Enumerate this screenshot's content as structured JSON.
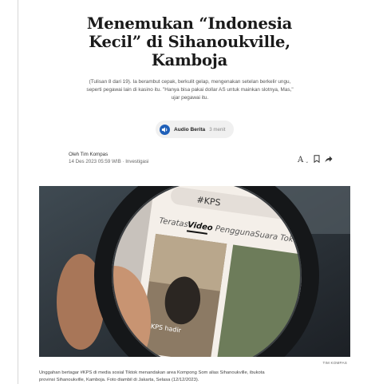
{
  "article": {
    "title_line1": "Menemukan “Indonesia",
    "title_line2": "Kecil” di Sihanoukville,",
    "title_line3": "Kamboja",
    "lede_line1": "(Tulisan 8 dari 19). Ia berambut cepak, berkulit gelap, mengenakan setelan berkelir ungu,",
    "lede_line2": "seperti pegawai lain di kasino itu. \"Hanya bisa pakai dollar AS untuk mainkan slotnya, Mas,\"",
    "lede_line3": "ujar pegawai itu."
  },
  "audio": {
    "label": "Audio Berita",
    "duration": "3 menit",
    "icon": "speaker-icon",
    "accent": "#1f5fb8"
  },
  "byline": {
    "author_line": "Oleh Tim Kompas",
    "date_line": "14 Des 2023 05:59 WIB · Investigasi"
  },
  "toolbar": {
    "font_size_label": "A",
    "font_chevron_icon": "chevron-down-icon",
    "bookmark_icon": "bookmark-icon",
    "share_icon": "share-icon"
  },
  "photo": {
    "search_query": "#KPS",
    "tabs": [
      "Teratas",
      "Video",
      "Pengguna",
      "Suara",
      "Toko"
    ],
    "active_tab": "Video",
    "overlay_text": "KPS hadir",
    "credit": "TIM KOMPAS"
  },
  "caption": {
    "line1": "Unggahan bertagar #KPS di media sosial Tiktok menandakan area Kompong Som alias Sihanoukville, ibukota",
    "line2": "provinsi Sihanoukville, Kamboja. Foto diambil di Jakarta, Selasa (12/12/2023)."
  }
}
